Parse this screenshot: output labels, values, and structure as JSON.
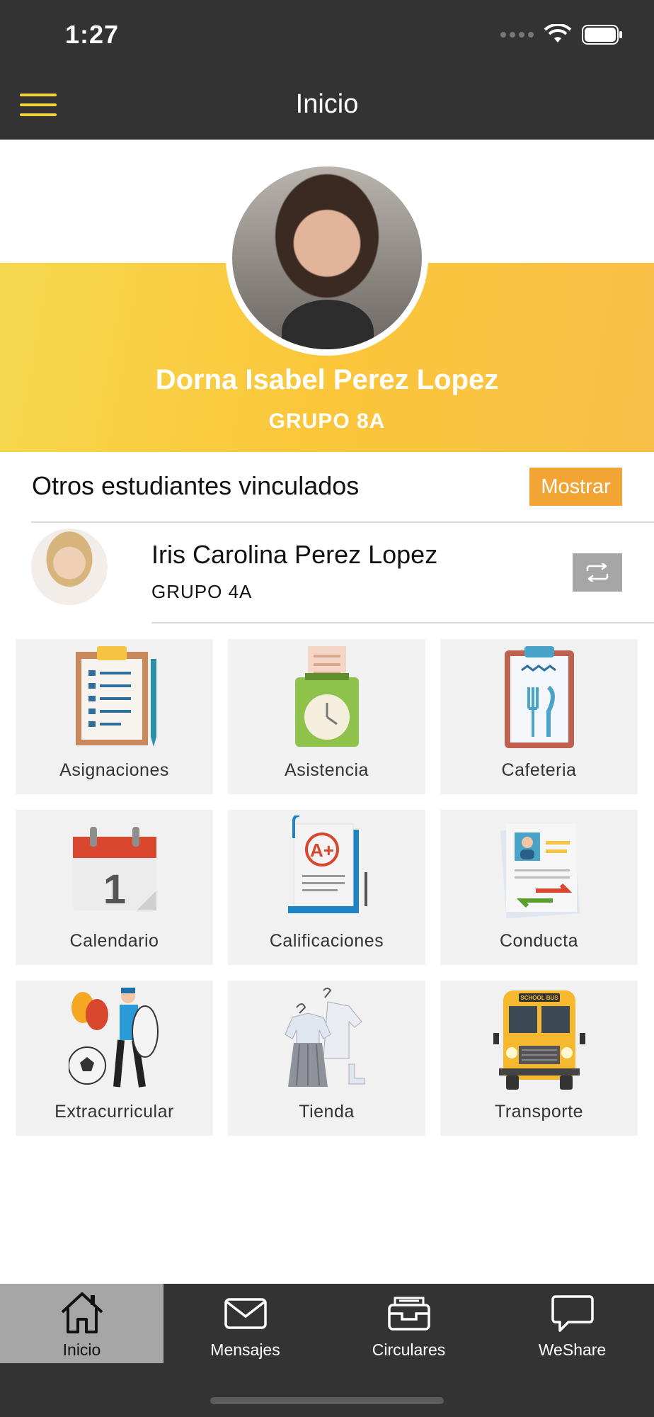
{
  "status_bar": {
    "time": "1:27"
  },
  "nav": {
    "title": "Inicio"
  },
  "profile": {
    "name": "Dorna Isabel Perez Lopez",
    "group": "GRUPO 8A"
  },
  "linked": {
    "title": "Otros estudiantes vinculados",
    "show_label": "Mostrar",
    "students": [
      {
        "name": "Iris Carolina Perez Lopez",
        "group": "GRUPO 4A"
      }
    ]
  },
  "grid": [
    {
      "label": "Asignaciones",
      "icon": "clipboard-icon"
    },
    {
      "label": "Asistencia",
      "icon": "time-clock-icon"
    },
    {
      "label": "Cafeteria",
      "icon": "menu-cutlery-icon"
    },
    {
      "label": "Calendario",
      "icon": "calendar-icon"
    },
    {
      "label": "Calificaciones",
      "icon": "grade-report-icon"
    },
    {
      "label": "Conducta",
      "icon": "conduct-card-icon"
    },
    {
      "label": "Extracurricular",
      "icon": "activities-icon"
    },
    {
      "label": "Tienda",
      "icon": "uniform-icon"
    },
    {
      "label": "Transporte",
      "icon": "school-bus-icon"
    }
  ],
  "tabs": [
    {
      "label": "Inicio",
      "icon": "home-icon",
      "active": true
    },
    {
      "label": "Mensajes",
      "icon": "envelope-icon"
    },
    {
      "label": "Circulares",
      "icon": "inbox-tray-icon"
    },
    {
      "label": "WeShare",
      "icon": "chat-bubble-icon"
    }
  ],
  "colors": {
    "bar_bg": "#333333",
    "accent_yellow": "#fbc63a",
    "button_orange": "#f2a534",
    "tile_bg": "#f1f1f1"
  }
}
